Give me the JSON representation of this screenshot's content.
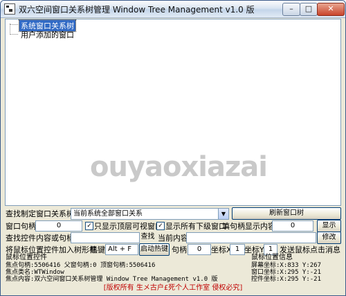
{
  "window": {
    "title": "双六空间窗口关系树管理 Window Tree Management v1.0 版",
    "min_symbol": "–",
    "max_symbol": "□",
    "close_symbol": "✕"
  },
  "tree": {
    "nodes": [
      "系统窗口关系树",
      "用户添加的窗口"
    ]
  },
  "watermark": "ouyaoxiazai",
  "controls": {
    "find_window_label": "查找制定窗口关系树",
    "relation_select_value": "当前系统全部窗口关系",
    "refresh_button": "刷新窗口树",
    "handle_label": "窗口句柄",
    "handle_value": "0",
    "top_visible_label": "只显示顶层可视窗口",
    "show_children_label": "显示所有下级窗口",
    "fill_handle_label": "填句柄显示内容",
    "fill_handle_value": "0",
    "show_button": "显示",
    "find_content_label": "查找控件内容或句柄",
    "find_content_value": "",
    "find_button": "查找",
    "current_content_label": "当前内容",
    "current_content_value": "",
    "modify_button": "修改",
    "add_to_tree_label": "将鼠标位置控件加入树形框",
    "hotkey_label": "热键",
    "hotkey_value": "Alt + F",
    "start_hotkey_button": "启动热键",
    "handle2_label": "句柄",
    "handle2_value": "0",
    "coord_x_label": "坐标X",
    "coord_x_value": "1",
    "coord_y_label": "坐标Y",
    "coord_y_value": "1",
    "send_click_label": "发送鼠标点击消息"
  },
  "mouse_control": {
    "header": "鼠标位置控件",
    "line1": "焦点句柄:5506416  父窗句柄:0   顶窗句柄:5506416",
    "line2": "焦点类名:WTWindow",
    "line3": "焦点内容:双六空间窗口关系树管理 Window Tree Management v1.0 版"
  },
  "mouse_info": {
    "header": "鼠标位置信息",
    "screen": "屏幕坐标:X:833 Y:267",
    "window": "窗口坐标:X:295 Y:-21",
    "control": "控件坐标:X:295 Y:-21"
  },
  "footer": "[版权所有 生メ古户£死个人工作室 侵权必究]"
}
